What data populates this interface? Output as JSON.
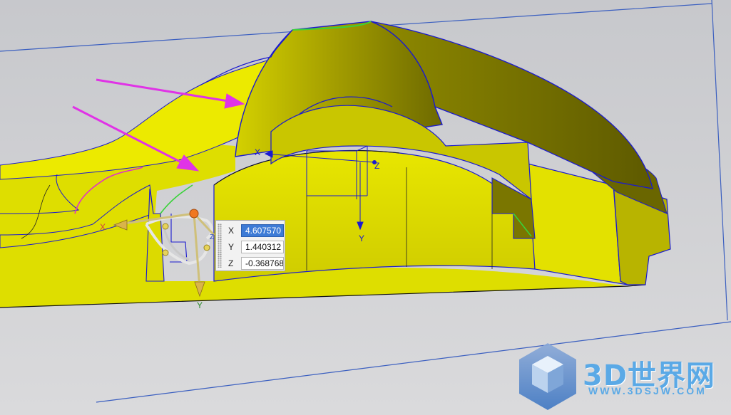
{
  "coord_input": {
    "x_label": "X",
    "x_value": "4.607570",
    "y_label": "Y",
    "y_value": "1.440312",
    "z_label": "Z",
    "z_value": "-0.368768"
  },
  "triad": {
    "x_label": "X",
    "y_label": "Y",
    "z_label": "Z"
  },
  "manipulator": {
    "x_label": "X",
    "y_label": "Y",
    "z_label": "Z"
  },
  "watermark": {
    "brand": "3D世界网",
    "url": "WWW.3DSJW.COM"
  },
  "colors": {
    "background": "#cfcfd2",
    "part_yellow": "#d8d800",
    "edge_blue": "#1a1acf",
    "arrow_magenta": "#e033e6",
    "coord_selected": "#3d7bd6"
  }
}
